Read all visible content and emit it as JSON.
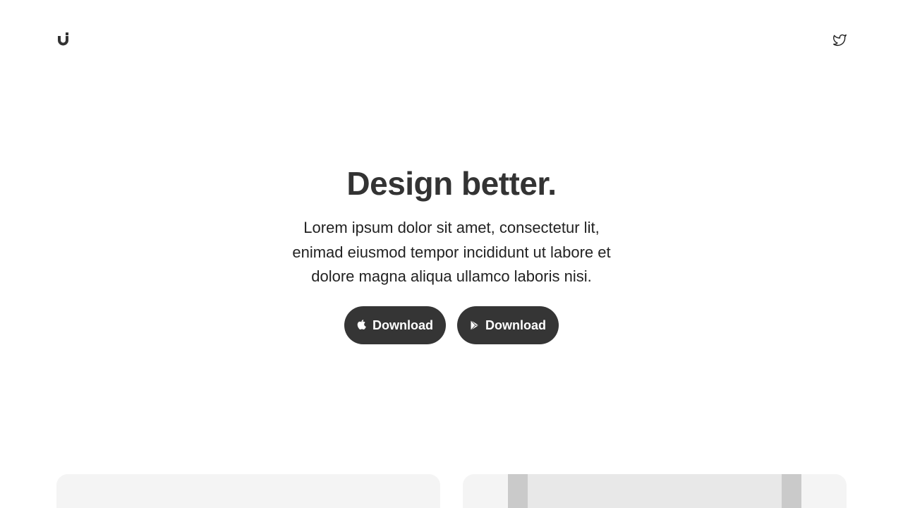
{
  "header": {
    "logo_icon": "u-logo-icon",
    "twitter_icon": "twitter-bird-icon"
  },
  "hero": {
    "title": "Design better.",
    "description_lines": [
      "Lorem ipsum dolor sit amet, consectetur lit,",
      "enimad eiusmod tempor incididunt ut labore et",
      "dolore magna aliqua ullamco laboris nisi."
    ]
  },
  "buttons": {
    "apple": {
      "label": "Download",
      "icon": "apple-icon"
    },
    "google_play": {
      "label": "Download",
      "icon": "google-play-icon"
    }
  },
  "colors": {
    "text_dark": "#333333",
    "button_bg": "#353535",
    "button_text": "#ffffff",
    "card_bg": "#f4f4f4",
    "device_bg": "#e8e8e8",
    "device_edge": "#cacaca"
  }
}
